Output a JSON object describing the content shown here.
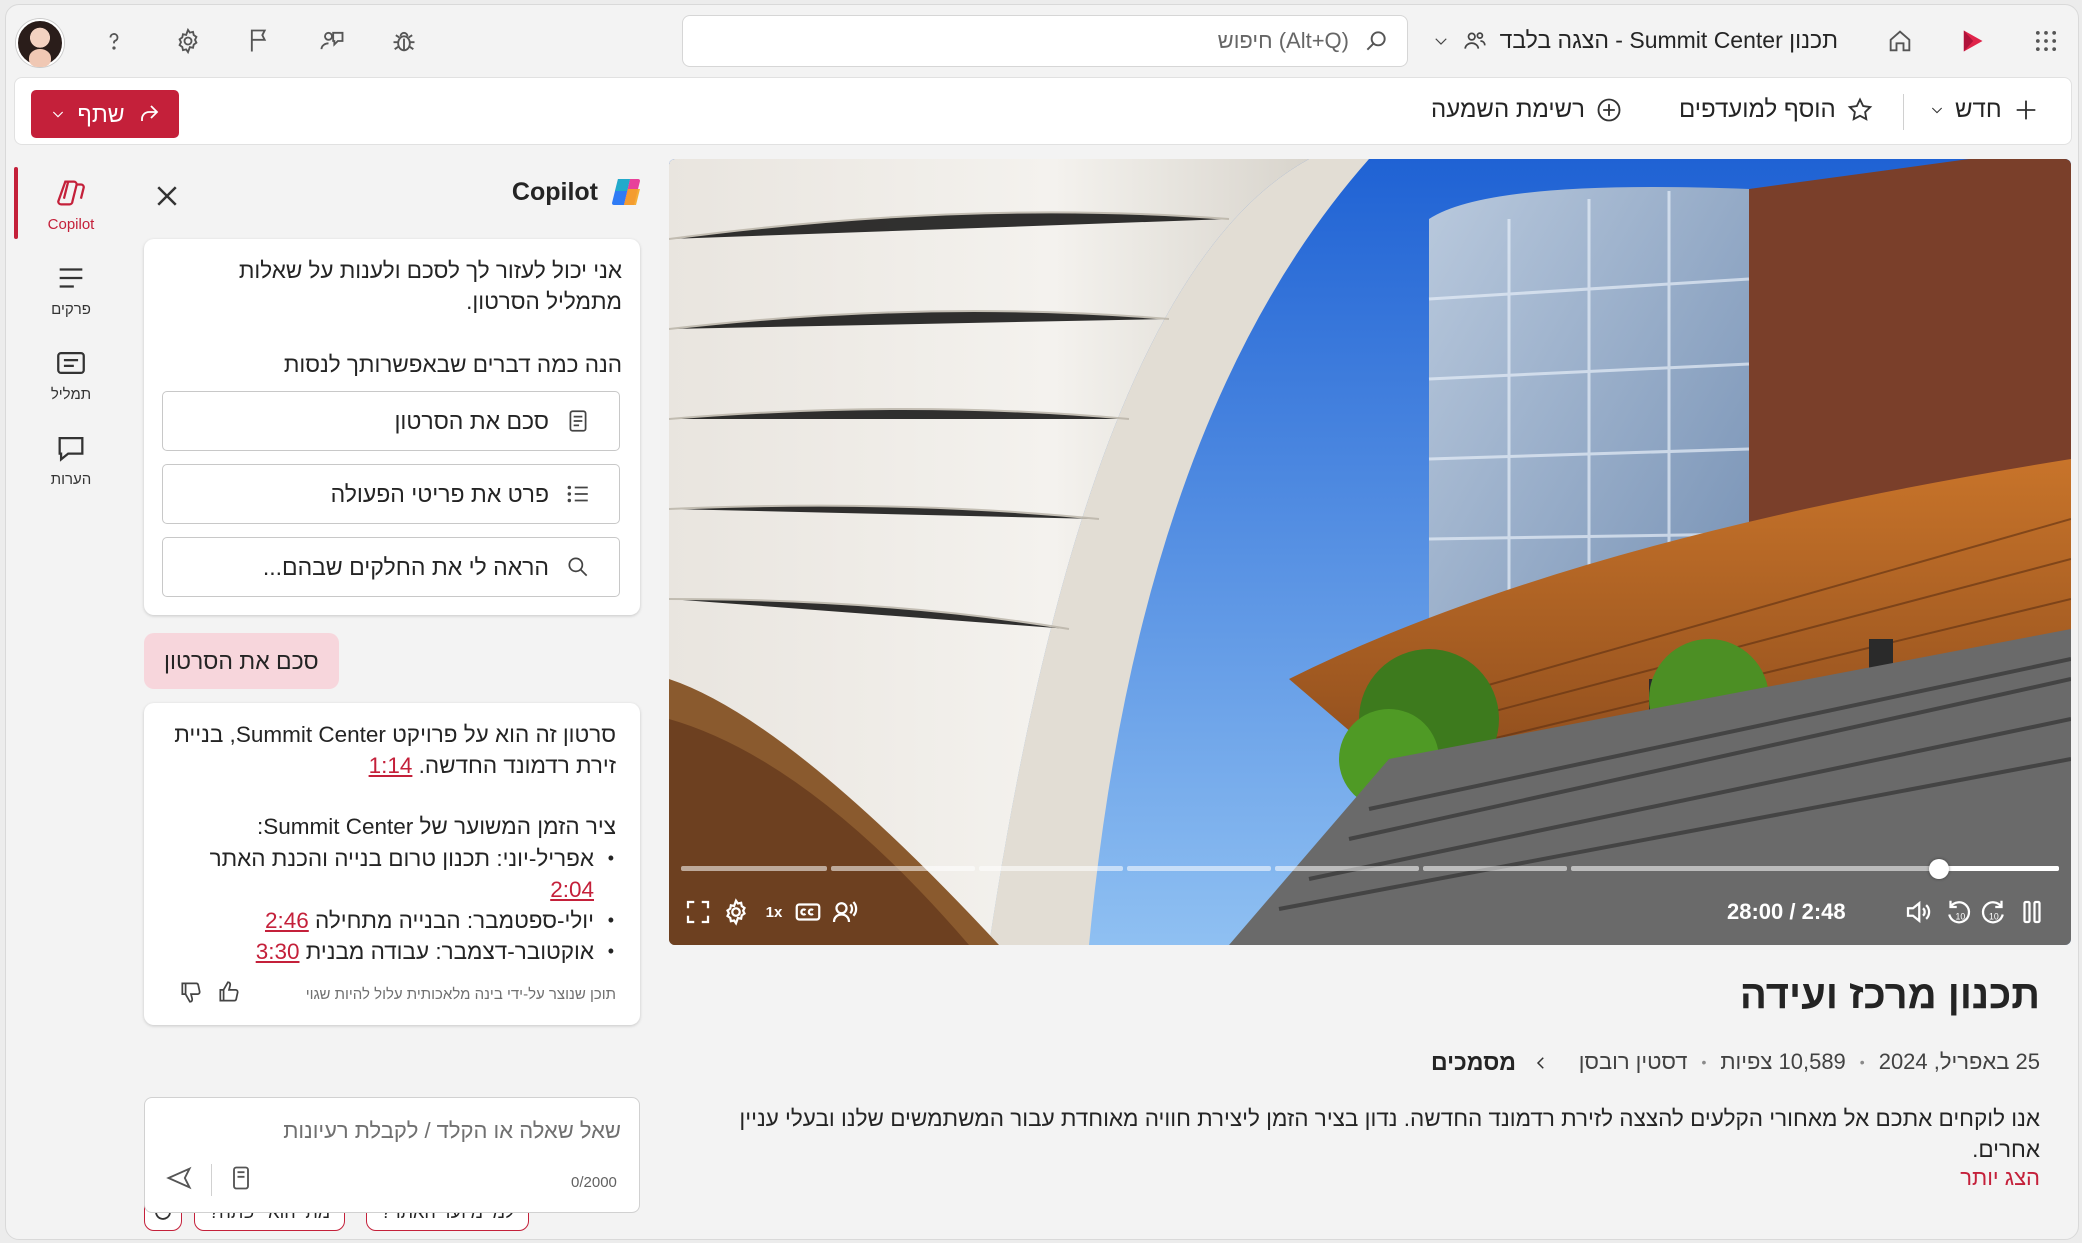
{
  "topbar": {
    "site_title": "תכנון Summit Center - הצגה בלבד",
    "search_placeholder": "חיפוש (Alt+Q)",
    "icons": [
      "waffle-icon",
      "stream-logo-icon",
      "home-icon",
      "bug-icon",
      "feedback-icon",
      "flag-icon",
      "settings-icon",
      "help-icon"
    ]
  },
  "commandbar": {
    "new_label": "חדש",
    "favorite_label": "הוסף למועדפים",
    "watchlist_label": "רשימת השמעה",
    "share_label": "שתף"
  },
  "rail": {
    "items": [
      {
        "label": "Copilot",
        "icon": "copilot-icon",
        "active": true
      },
      {
        "label": "פרקים",
        "icon": "chapters-icon"
      },
      {
        "label": "תמליל",
        "icon": "transcript-icon"
      },
      {
        "label": "הערות",
        "icon": "comments-icon"
      }
    ]
  },
  "copilot": {
    "title": "Copilot",
    "intro": "אני יכול לעזור לך לסכם ולענות על שאלות מתמליל הסרטון.",
    "suggest_heading": "הנה כמה דברים שבאפשרותך לנסות",
    "prompts": [
      "סכם את הסרטון",
      "פרט את פריטי הפעולה",
      "הראה לי את החלקים שבהם..."
    ],
    "user_message": "סכם את הסרטון",
    "answer": {
      "intro_text": "סרטון זה הוא על פרויקט Summit Center, בניית זירת רדמונד החדשה.",
      "intro_ts": "1:14",
      "timeline_heading": "ציר הזמן המשוער של Summit Center:",
      "items": [
        {
          "text": "אפריל-יוני: תכנון טרום בנייה והכנת האתר",
          "ts": "2:04"
        },
        {
          "text": "יולי-ספטמבר: הבנייה מתחילה",
          "ts": "2:46"
        },
        {
          "text": "אוקטובר-דצמבר: עבודה מבנית",
          "ts": "3:30"
        }
      ],
      "disclaimer": "תוכן שנוצר על-ידי בינה מלאכותית עלול להיות שגוי"
    },
    "chips": [
      "למי מיועד האתר?",
      "מתי הוא ייפתח?"
    ],
    "composer_placeholder": "שאל שאלה או הקלד / לקבלת רעיונות",
    "composer_count": "0/2000"
  },
  "video": {
    "time": "28:00 / 2:48",
    "speed": "1x",
    "progress_fraction": 0.087,
    "title": "תכנון מרכז ועידה",
    "date": "25 באפריל, 2024",
    "views": "10,589 צפיות",
    "author": "דסטין רובסן",
    "breadcrumb": "מסמכים",
    "description": "אנו לוקחים אתכם אל מאחורי הקלעים להצצה לזירת רדמונד החדשה. נדון בציר הזמן ליצירת חוויה מאוחדת עבור המשתמשים שלנו ובעלי עניין אחרים.",
    "show_more": "הצג יותר"
  },
  "colors": {
    "accent": "#c4203a",
    "chip_bg": "#f7d6dc"
  }
}
